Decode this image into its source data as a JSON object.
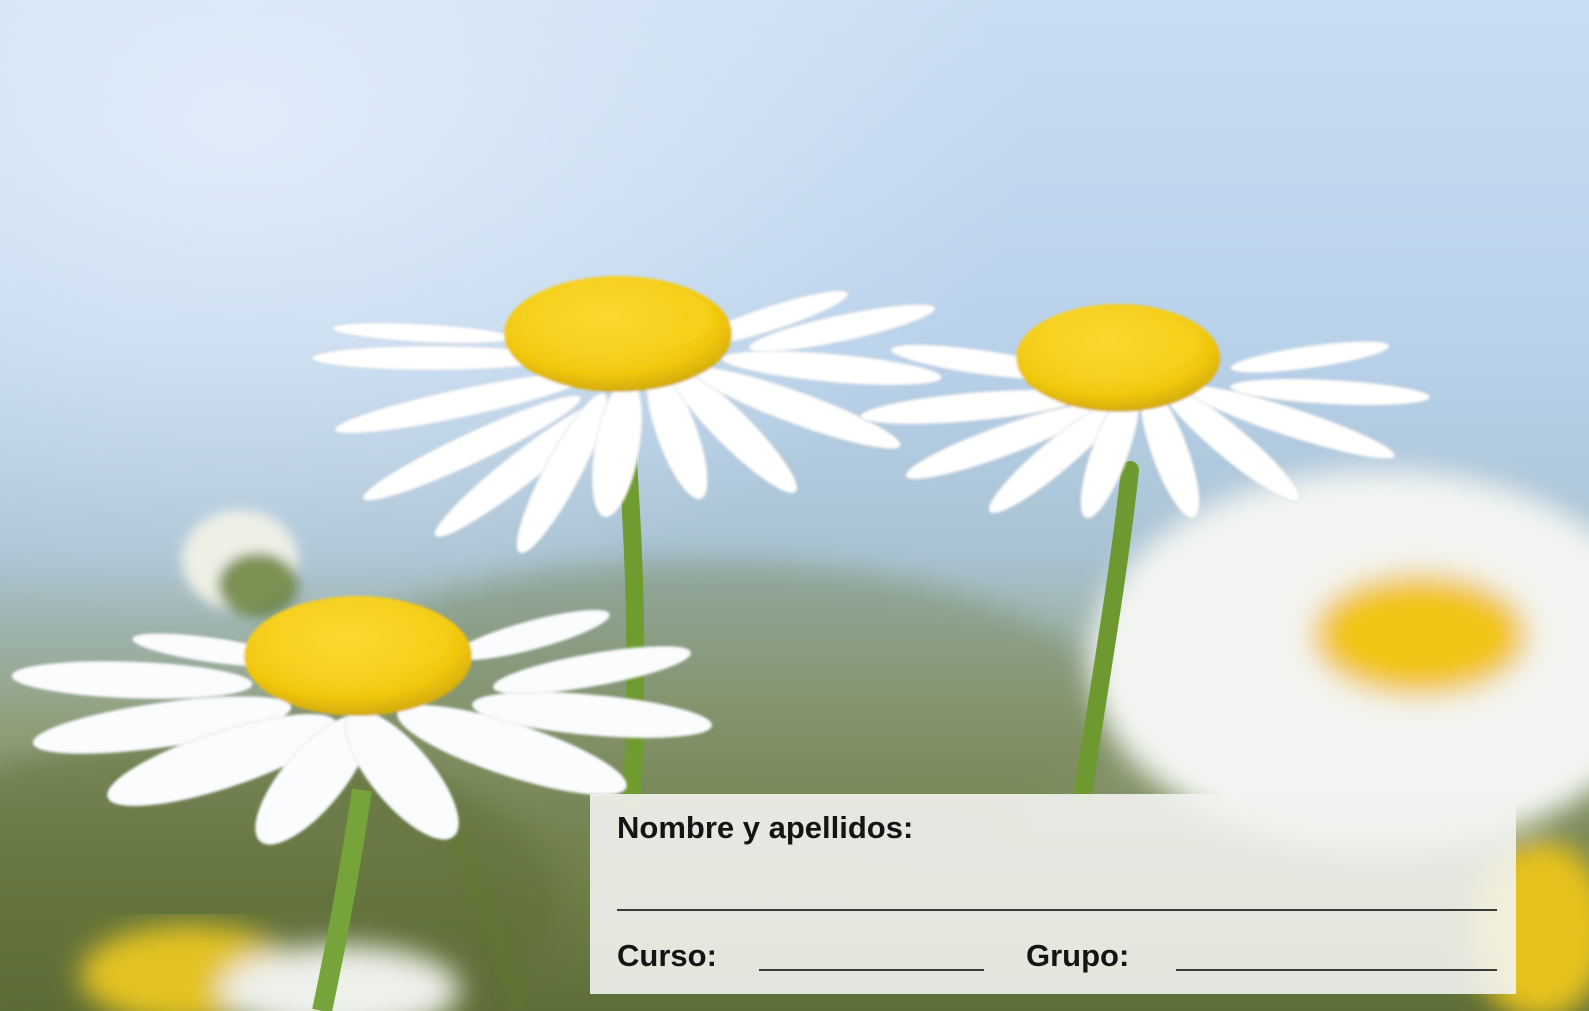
{
  "form": {
    "nombre_label": "Nombre y apellidos:",
    "curso_label": "Curso:",
    "grupo_label": "Grupo:"
  },
  "photo": {
    "subject": "daisy-flowers",
    "sky_color": "#c8dcf0",
    "petal_color": "#ffffff",
    "center_color": "#f2cf14",
    "stem_color": "#6e9a32"
  }
}
